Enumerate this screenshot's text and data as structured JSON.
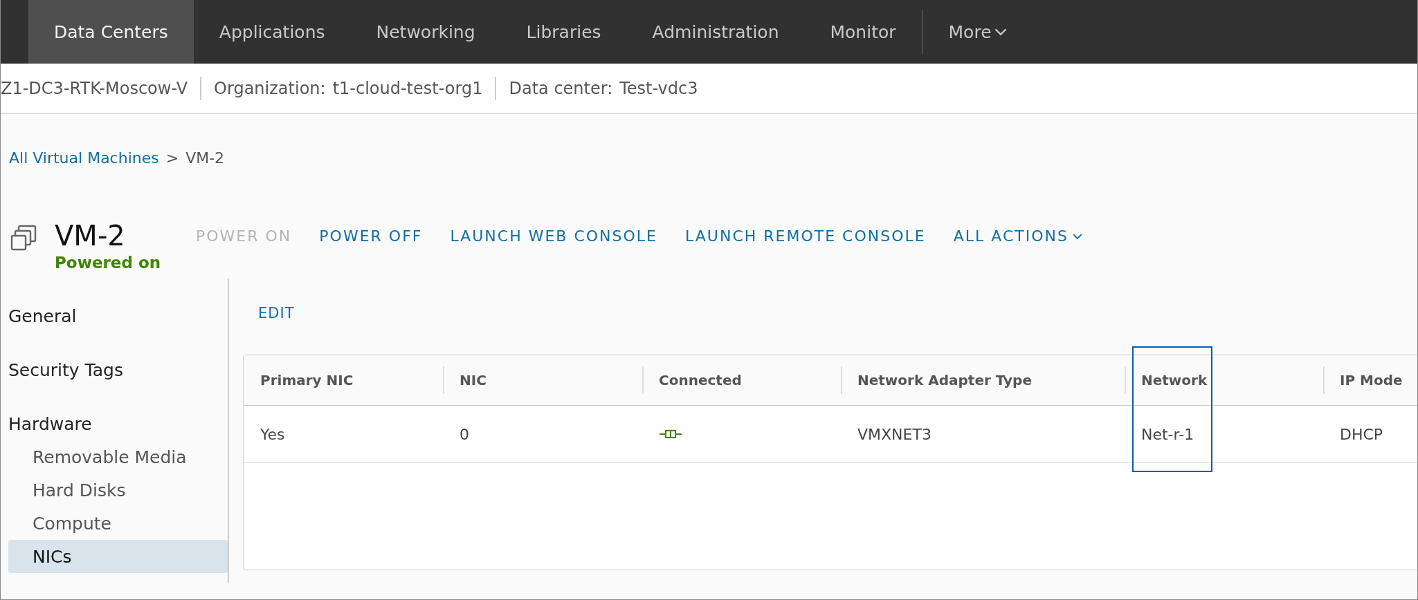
{
  "nav": {
    "tabs": [
      {
        "label": "Data Centers",
        "selected": true
      },
      {
        "label": "Applications",
        "selected": false
      },
      {
        "label": "Networking",
        "selected": false
      },
      {
        "label": "Libraries",
        "selected": false
      },
      {
        "label": "Administration",
        "selected": false
      },
      {
        "label": "Monitor",
        "selected": false
      }
    ],
    "more": "More"
  },
  "context_bar": {
    "site": "Z1-DC3-RTK-Moscow-V",
    "organization_label": "Organization:",
    "organization": "t1-cloud-test-org1",
    "data_center_label": "Data center:",
    "data_center": "Test-vdc3"
  },
  "breadcrumb": {
    "link": "All Virtual Machines",
    "separator": ">",
    "current": "VM-2"
  },
  "vm": {
    "name": "VM-2",
    "status": "Powered on",
    "actions": [
      {
        "label": "POWER ON",
        "disabled": true,
        "dropdown": false
      },
      {
        "label": "POWER OFF",
        "disabled": false,
        "dropdown": false
      },
      {
        "label": "LAUNCH WEB CONSOLE",
        "disabled": false,
        "dropdown": false
      },
      {
        "label": "LAUNCH REMOTE CONSOLE",
        "disabled": false,
        "dropdown": false
      },
      {
        "label": "ALL ACTIONS",
        "disabled": false,
        "dropdown": true
      }
    ]
  },
  "sidebar": {
    "items": [
      {
        "label": "General",
        "selected": false
      },
      {
        "label": "Security Tags",
        "selected": false
      },
      {
        "label": "Hardware",
        "selected": false,
        "children": [
          {
            "label": "Removable Media",
            "selected": false
          },
          {
            "label": "Hard Disks",
            "selected": false
          },
          {
            "label": "Compute",
            "selected": false
          },
          {
            "label": "NICs",
            "selected": true
          }
        ]
      }
    ]
  },
  "edit_button": "EDIT",
  "table": {
    "columns": [
      {
        "label": "Primary NIC",
        "highlighted": false
      },
      {
        "label": "NIC",
        "highlighted": false
      },
      {
        "label": "Connected",
        "highlighted": false
      },
      {
        "label": "Network Adapter Type",
        "highlighted": false
      },
      {
        "label": "Network",
        "highlighted": true
      },
      {
        "label": "IP Mode",
        "highlighted": false
      }
    ],
    "rows": [
      {
        "primary_nic": "Yes",
        "nic": "0",
        "connected": true,
        "adapter_type": "VMXNET3",
        "network": "Net-r-1",
        "ip_mode": "DHCP"
      }
    ]
  }
}
